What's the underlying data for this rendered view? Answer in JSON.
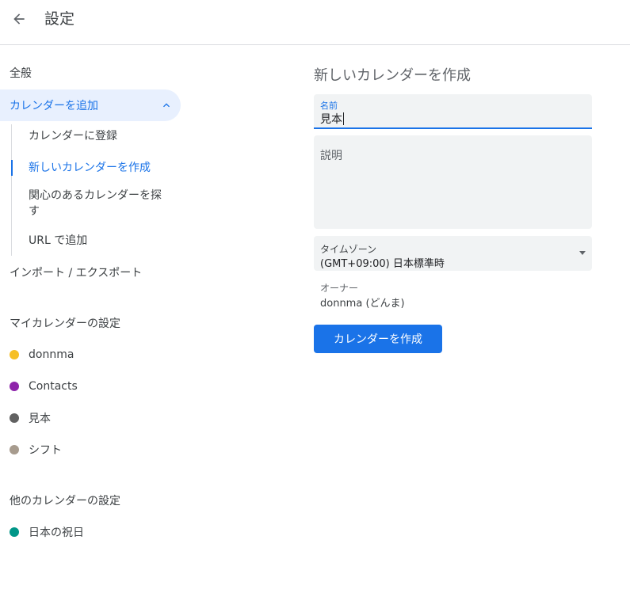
{
  "header": {
    "back_icon": "arrow-left-icon",
    "title": "設定"
  },
  "sidebar": {
    "general": "全般",
    "add_calendar": "カレンダーを追加",
    "add_calendar_chevron": "chevron-up-icon",
    "sub_items": [
      {
        "label": "カレンダーに登録",
        "active": false
      },
      {
        "label": "新しいカレンダーを作成",
        "active": true
      },
      {
        "label": "関心のあるカレンダーを探\nす",
        "active": false
      },
      {
        "label": "URL で追加",
        "active": false
      }
    ],
    "import_export": "インポート / エクスポート",
    "my_calendars_header": "マイカレンダーの設定",
    "my_calendars": [
      {
        "name": "donnma",
        "color": "#f6bf26"
      },
      {
        "name": "Contacts",
        "color": "#8e24aa"
      },
      {
        "name": "見本",
        "color": "#616161"
      },
      {
        "name": "シフト",
        "color": "#a79b8e"
      }
    ],
    "other_calendars_header": "他のカレンダーの設定",
    "other_calendars": [
      {
        "name": "日本の祝日",
        "color": "#009688"
      }
    ]
  },
  "form": {
    "heading": "新しいカレンダーを作成",
    "name_label": "名前",
    "name_value": "見本",
    "description_placeholder": "説明",
    "timezone_label": "タイムゾーン",
    "timezone_value": "(GMT+09:00) 日本標準時",
    "owner_label": "オーナー",
    "owner_value": "donnma (どんま)",
    "create_button": "カレンダーを作成"
  },
  "colors": {
    "accent": "#1a73e8",
    "selected_bg": "#e8f0fe",
    "field_bg": "#f1f3f4"
  }
}
